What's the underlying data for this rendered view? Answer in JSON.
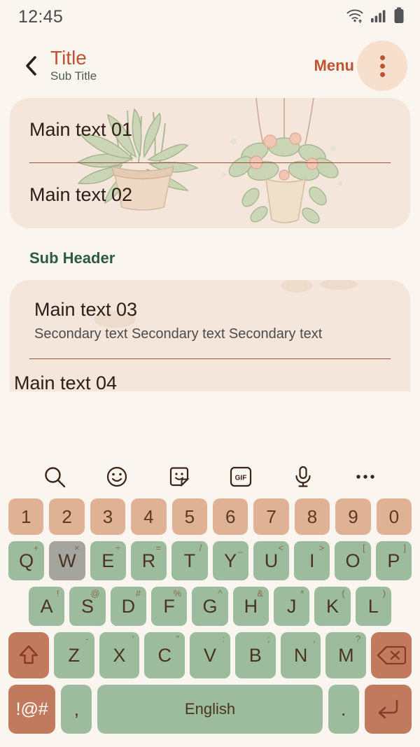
{
  "status_bar": {
    "time": "12:45",
    "icons": [
      "wifi-icon",
      "signal-icon",
      "battery-icon"
    ]
  },
  "app_bar": {
    "back_icon": "chevron-left-icon",
    "title": "Title",
    "subtitle": "Sub Title",
    "menu_label": "Menu",
    "overflow_icon": "more-vertical-icon"
  },
  "content": {
    "card1": {
      "rows": [
        {
          "main": "Main text 01"
        },
        {
          "main": "Main text 02"
        }
      ]
    },
    "sub_header": "Sub Header",
    "card2": {
      "rows": [
        {
          "main": "Main text 03",
          "secondary": "Secondary text Secondary text Secondary text"
        },
        {
          "main": "Main text 04"
        }
      ]
    }
  },
  "keyboard": {
    "toolbar": [
      {
        "name": "search-icon"
      },
      {
        "name": "emoji-icon"
      },
      {
        "name": "sticker-icon"
      },
      {
        "name": "gif-icon",
        "label": "GIF"
      },
      {
        "name": "microphone-icon"
      },
      {
        "name": "more-horizontal-icon"
      }
    ],
    "number_row": [
      "1",
      "2",
      "3",
      "4",
      "5",
      "6",
      "7",
      "8",
      "9",
      "0"
    ],
    "row_q": [
      {
        "key": "Q",
        "sup": "+"
      },
      {
        "key": "W",
        "sup": "×",
        "pressed": true
      },
      {
        "key": "E",
        "sup": "÷"
      },
      {
        "key": "R",
        "sup": "="
      },
      {
        "key": "T",
        "sup": "/"
      },
      {
        "key": "Y",
        "sup": "_"
      },
      {
        "key": "U",
        "sup": "<"
      },
      {
        "key": "I",
        "sup": ">"
      },
      {
        "key": "O",
        "sup": "["
      },
      {
        "key": "P",
        "sup": "]"
      }
    ],
    "row_a": [
      {
        "key": "A",
        "sup": "!"
      },
      {
        "key": "S",
        "sup": "@"
      },
      {
        "key": "D",
        "sup": "#"
      },
      {
        "key": "F",
        "sup": "%"
      },
      {
        "key": "G",
        "sup": "^"
      },
      {
        "key": "H",
        "sup": "&"
      },
      {
        "key": "J",
        "sup": "*"
      },
      {
        "key": "K",
        "sup": "("
      },
      {
        "key": "L",
        "sup": ")"
      }
    ],
    "row_z": [
      {
        "key": "Z",
        "sup": "-"
      },
      {
        "key": "X",
        "sup": "'"
      },
      {
        "key": "C",
        "sup": "\""
      },
      {
        "key": "V",
        "sup": ":"
      },
      {
        "key": "B",
        "sup": ";"
      },
      {
        "key": "N",
        "sup": ","
      },
      {
        "key": "M",
        "sup": "?"
      }
    ],
    "shift_icon": "shift-arrow-icon",
    "backspace_icon": "backspace-icon",
    "bottom_row": {
      "symbols_label": "!@#",
      "comma_label": ",",
      "space_label": "English",
      "period_label": ".",
      "enter_icon": "enter-return-icon"
    }
  },
  "colors": {
    "page_background": "#fbf5ef",
    "card_background": "#f5e6db",
    "accent_terracotta": "#c0522f",
    "key_green": "#9dbc9e",
    "key_tan": "#dfb295",
    "key_accent": "#c27a5e",
    "key_pressed": "#a5a5a0",
    "sub_header_green": "#2f5a42",
    "divider": "#8a3a28"
  }
}
